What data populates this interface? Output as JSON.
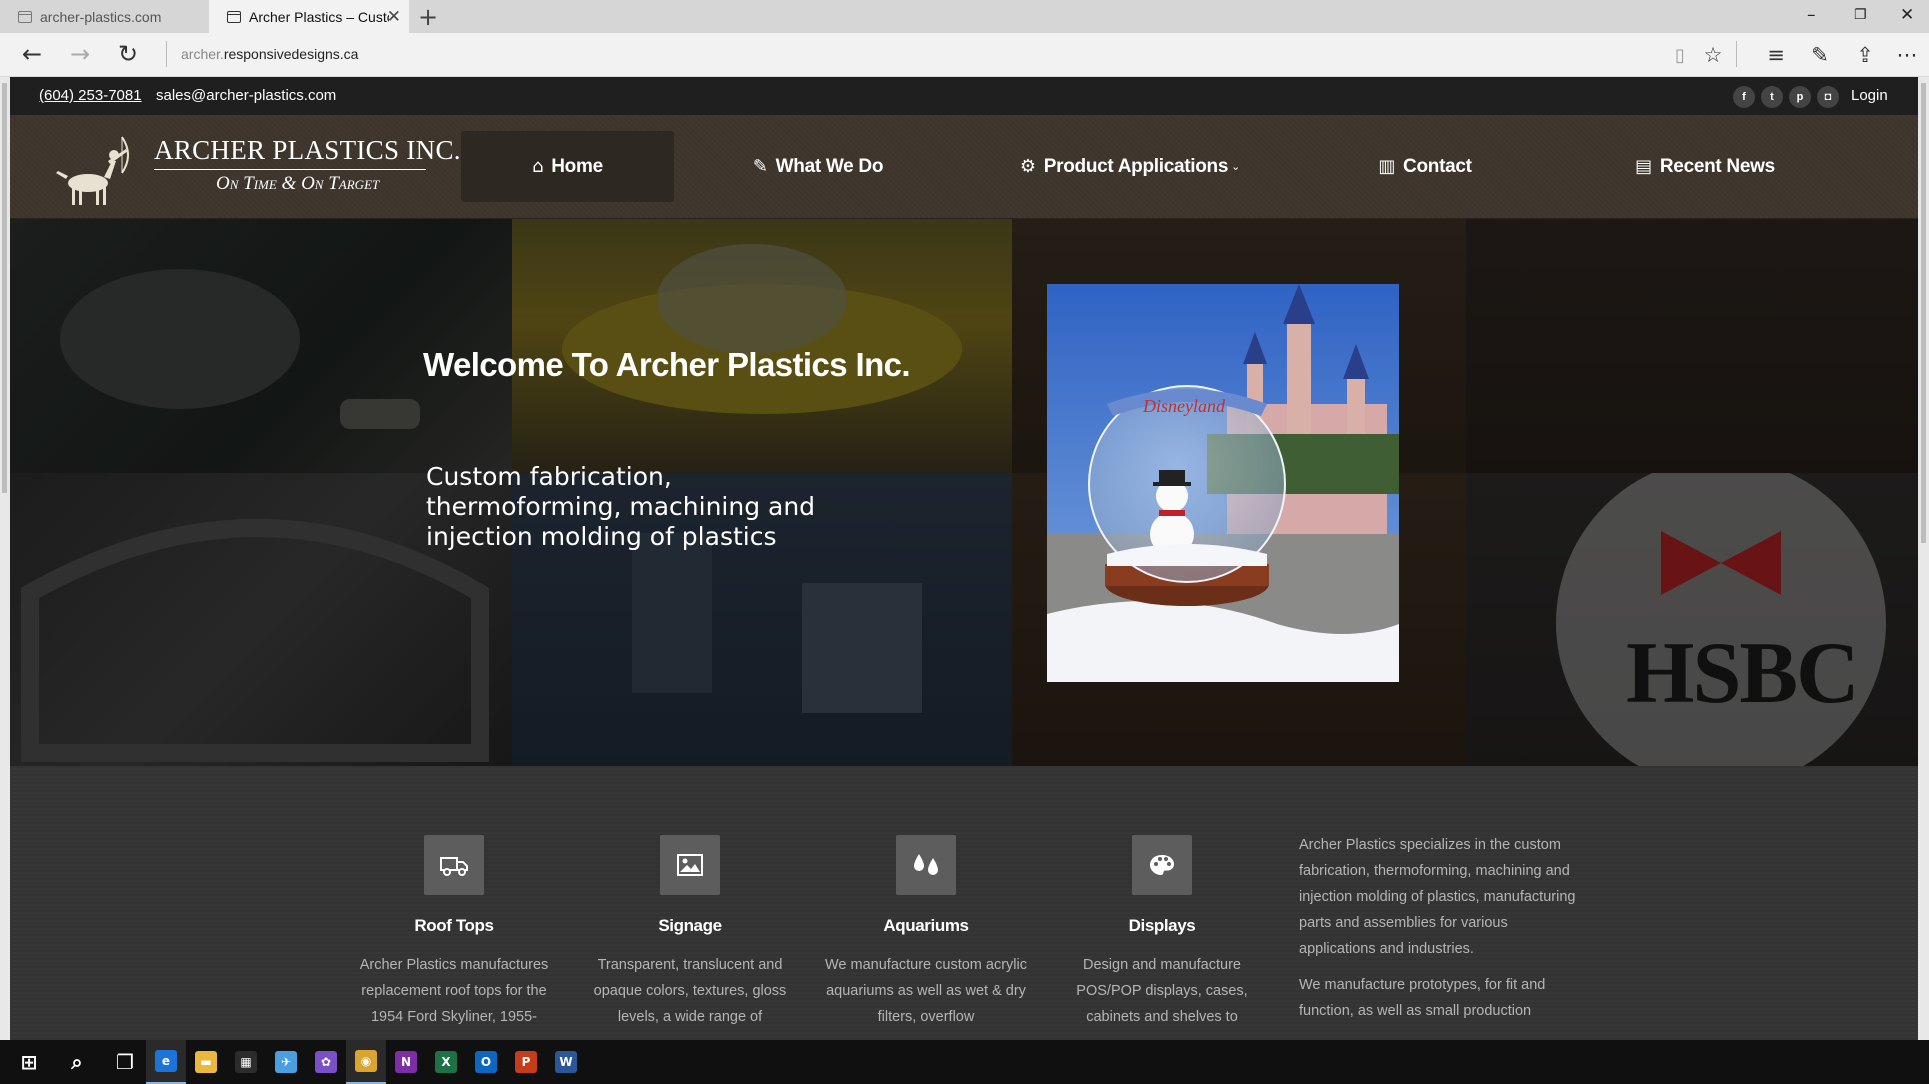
{
  "browser": {
    "tabs": [
      {
        "title": "archer-plastics.com"
      },
      {
        "title": "Archer Plastics – Custom"
      }
    ],
    "url_prefix": "archer.",
    "url_domain": "responsivedesigns.ca",
    "icons": {
      "back": "back-arrow-icon",
      "forward": "forward-arrow-icon",
      "refresh": "refresh-icon",
      "reading": "reading-view-icon",
      "favorite": "star-icon",
      "hub": "hub-icon",
      "note": "web-note-icon",
      "share": "share-icon",
      "more": "more-icon"
    }
  },
  "topbar": {
    "phone": "(604) 253-7081",
    "email": "sales@archer-plastics.com",
    "social": [
      {
        "name": "facebook-icon",
        "glyph": "f"
      },
      {
        "name": "twitter-icon",
        "glyph": "t"
      },
      {
        "name": "pinterest-icon",
        "glyph": "p"
      },
      {
        "name": "instagram-icon",
        "glyph": "◘"
      }
    ],
    "login": "Login"
  },
  "logo": {
    "title": "ARCHER PLASTICS INC.",
    "tagline": "On Time & On Target"
  },
  "nav": [
    {
      "label": "Home",
      "icon": "⌂",
      "active": true
    },
    {
      "label": "What We Do",
      "icon": "✎",
      "active": false
    },
    {
      "label": "Product Applications",
      "icon": "⚙",
      "active": false,
      "dropdown": true
    },
    {
      "label": "Contact",
      "icon": "▥",
      "active": false
    },
    {
      "label": "Recent News",
      "icon": "▤",
      "active": false
    }
  ],
  "hero": {
    "title": "Welcome To Archer Plastics Inc.",
    "subtitle": "Custom fabrication, thermoforming, machining and injection molding of plastics",
    "photo_sign": "Disneyland"
  },
  "services": [
    {
      "title": "Roof Tops",
      "icon": "truck-icon",
      "desc": "Archer Plastics manufactures replacement roof tops for the 1954 Ford Skyliner, 1955-"
    },
    {
      "title": "Signage",
      "icon": "image-icon",
      "desc": "Transparent, translucent and opaque colors, textures, gloss levels, a wide range of"
    },
    {
      "title": "Aquariums",
      "icon": "water-drops-icon",
      "desc": "We manufacture custom acrylic aquariums as well as wet & dry filters, overflow"
    },
    {
      "title": "Displays",
      "icon": "palette-icon",
      "desc": "Design and manufacture POS/POP displays, cases, cabinets and shelves to"
    }
  ],
  "about": {
    "p1": "Archer Plastics specializes in the custom fabrication, thermoforming, machining and injection molding of plastics, manufacturing parts and assemblies for various applications and industries.",
    "p2": "We manufacture prototypes, for fit and function, as well as small production"
  },
  "hero_tiles": {
    "hsbc": "HSBC"
  },
  "taskbar": [
    {
      "name": "start-icon",
      "glyph": "⊞",
      "color": "#101010"
    },
    {
      "name": "search-icon",
      "glyph": "⌕",
      "color": "#101010"
    },
    {
      "name": "task-view-icon",
      "glyph": "❐",
      "color": "#101010"
    },
    {
      "name": "edge-icon",
      "glyph": "e",
      "color": "#1e73d8",
      "active": true
    },
    {
      "name": "file-explorer-icon",
      "glyph": "▬",
      "color": "#e8b93c"
    },
    {
      "name": "store-icon",
      "glyph": "▦",
      "color": "#2c2c2c"
    },
    {
      "name": "pen-app-icon",
      "glyph": "✈",
      "color": "#4a9fe0"
    },
    {
      "name": "photos-icon",
      "glyph": "✿",
      "color": "#7a4fc8"
    },
    {
      "name": "chrome-icon",
      "glyph": "◉",
      "color": "#d9a531",
      "active": true
    },
    {
      "name": "onenote-icon",
      "glyph": "N",
      "color": "#7b2ea5"
    },
    {
      "name": "excel-icon",
      "glyph": "X",
      "color": "#1e7145"
    },
    {
      "name": "outlook-icon",
      "glyph": "O",
      "color": "#0f66c2"
    },
    {
      "name": "powerpoint-icon",
      "glyph": "P",
      "color": "#c43e1c"
    },
    {
      "name": "word-icon",
      "glyph": "W",
      "color": "#2b579a"
    }
  ]
}
